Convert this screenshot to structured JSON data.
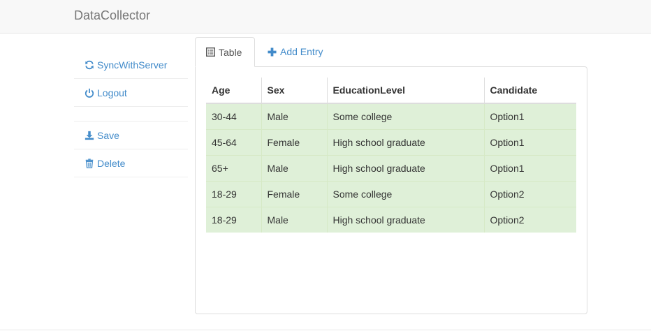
{
  "app": {
    "brand": "DataCollector"
  },
  "sidebar": {
    "items": [
      {
        "label": "SyncWithServer",
        "icon": "refresh-icon"
      },
      {
        "label": "Logout",
        "icon": "power-icon"
      },
      {
        "label": "Save",
        "icon": "download-icon"
      },
      {
        "label": "Delete",
        "icon": "trash-icon"
      }
    ]
  },
  "tabs": [
    {
      "label": "Table",
      "icon": "list-alt-icon",
      "active": true
    },
    {
      "label": "Add Entry",
      "icon": "plus-icon",
      "active": false
    }
  ],
  "table": {
    "columns": [
      "Age",
      "Sex",
      "EducationLevel",
      "Candidate"
    ],
    "rows": [
      [
        "30-44",
        "Male",
        "Some college",
        "Option1"
      ],
      [
        "45-64",
        "Female",
        "High school graduate",
        "Option1"
      ],
      [
        "65+",
        "Male",
        "High school graduate",
        "Option1"
      ],
      [
        "18-29",
        "Female",
        "Some college",
        "Option2"
      ],
      [
        "18-29",
        "Male",
        "High school graduate",
        "Option2"
      ]
    ]
  },
  "colors": {
    "link": "#428bca",
    "success_row": "#dff0d8",
    "navbar": "#f8f8f8"
  }
}
